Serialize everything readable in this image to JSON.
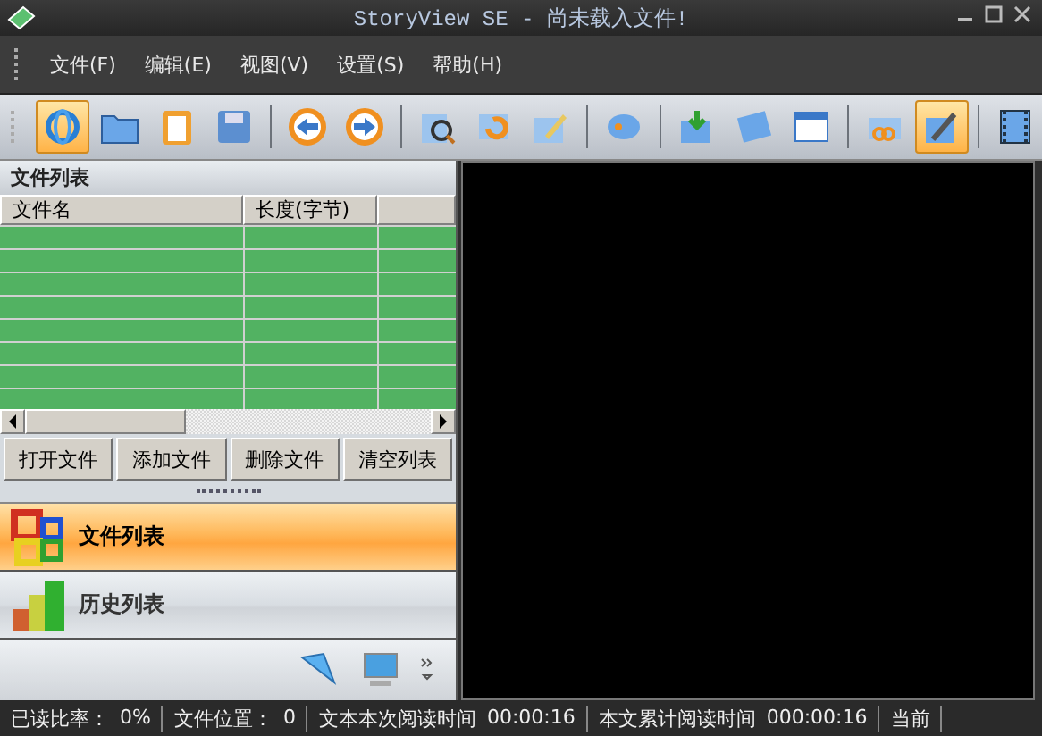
{
  "window": {
    "title": "StoryView SE - 尚未载入文件!"
  },
  "menu": [
    "文件(F)",
    "编辑(E)",
    "视图(V)",
    "设置(S)",
    "帮助(H)"
  ],
  "toolbar": [
    {
      "kind": "button",
      "selected": true
    },
    {
      "kind": "button",
      "selected": false
    },
    {
      "kind": "button",
      "selected": false
    },
    {
      "kind": "button",
      "selected": false
    },
    {
      "kind": "separator"
    },
    {
      "kind": "button",
      "selected": false
    },
    {
      "kind": "button",
      "selected": false
    },
    {
      "kind": "separator"
    },
    {
      "kind": "button",
      "selected": false
    },
    {
      "kind": "button",
      "selected": false
    },
    {
      "kind": "button",
      "selected": false
    },
    {
      "kind": "separator"
    },
    {
      "kind": "button",
      "selected": false
    },
    {
      "kind": "separator"
    },
    {
      "kind": "button",
      "selected": false
    },
    {
      "kind": "button",
      "selected": false
    },
    {
      "kind": "button",
      "selected": false
    },
    {
      "kind": "separator"
    },
    {
      "kind": "button",
      "selected": false
    },
    {
      "kind": "button",
      "selected": true
    },
    {
      "kind": "separator"
    },
    {
      "kind": "button",
      "selected": false
    }
  ],
  "file_panel": {
    "title": "文件列表",
    "columns": [
      "文件名",
      "长度(字节)"
    ],
    "buttons": [
      "打开文件",
      "添加文件",
      "删除文件",
      "清空列表"
    ]
  },
  "nav": [
    {
      "label": "文件列表",
      "selected": true
    },
    {
      "label": "历史列表",
      "selected": false
    }
  ],
  "status_bar": [
    {
      "label": "已读比率：",
      "value": "0%"
    },
    {
      "label": "文件位置：",
      "value": "0"
    },
    {
      "label": "文本本次阅读时间",
      "value": "00:00:16"
    },
    {
      "label": "本文累计阅读时间",
      "value": "000:00:16"
    },
    {
      "label": "当前"
    }
  ]
}
